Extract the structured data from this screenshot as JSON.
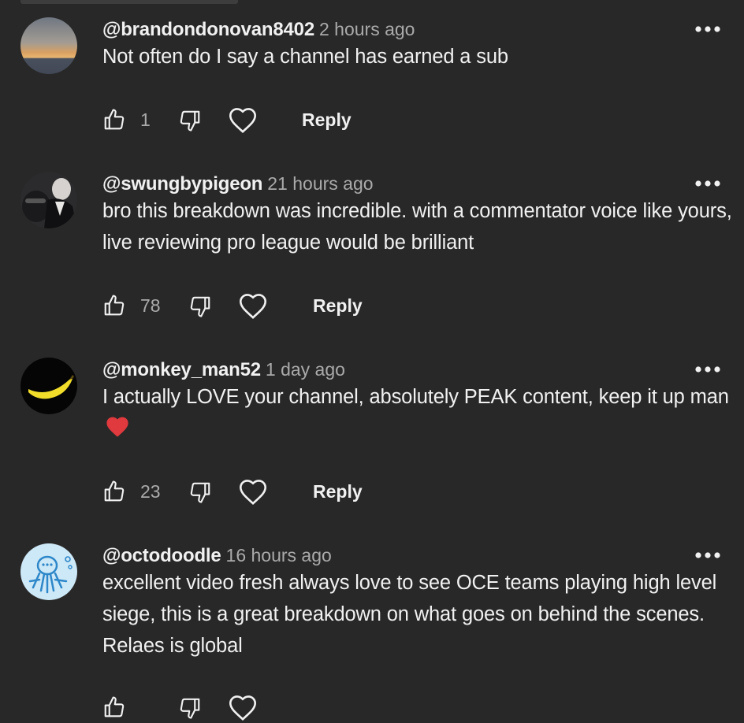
{
  "comments": [
    {
      "handle": "@brandondonovan8402",
      "time": "2 hours ago",
      "text": "Not often do I say a channel has earned a sub",
      "likes": "1",
      "reply_label": "Reply",
      "avatar": "sunset-photo"
    },
    {
      "handle": "@swungbypigeon",
      "time": "21 hours ago",
      "text": "bro this breakdown was incredible. with a commentator voice like yours, live reviewing pro league would be brilliant",
      "likes": "78",
      "reply_label": "Reply",
      "avatar": "suited-figure-photo"
    },
    {
      "handle": "@monkey_man52",
      "time": "1 day ago",
      "text": "I actually LOVE your channel, absolutely PEAK content, keep it up man",
      "emoji": "red-heart-emoji",
      "likes": "23",
      "reply_label": "Reply",
      "avatar": "banana-image"
    },
    {
      "handle": "@octodoodle",
      "time": "16 hours ago",
      "text": "excellent video fresh always love to see OCE teams playing high level siege, this is a great breakdown on what goes on behind the scenes. Relaes is global",
      "avatar": "octopus-doodle"
    }
  ],
  "icons": {
    "like": "thumbs-up-icon",
    "dislike": "thumbs-down-icon",
    "heart": "heart-outline-icon",
    "menu": "more-options-icon"
  },
  "colors": {
    "background": "#282828",
    "text": "#f1f1f1",
    "secondary_text": "#aaaaaa",
    "heart_emoji": "#e0393e"
  }
}
